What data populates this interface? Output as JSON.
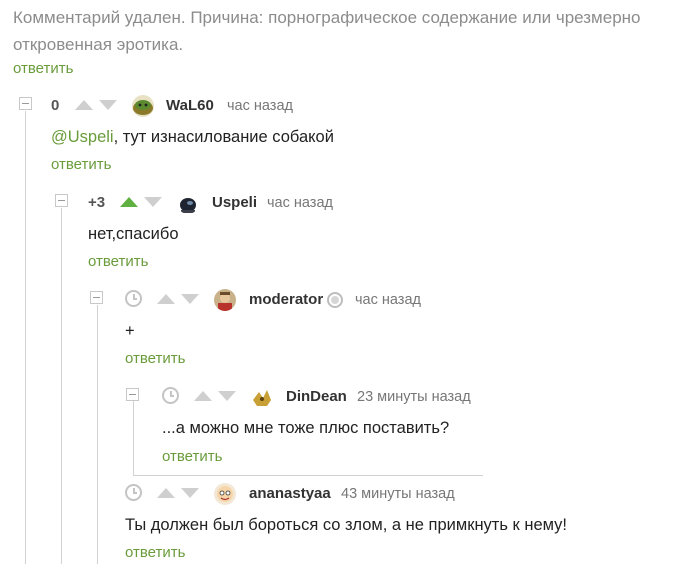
{
  "deleted_comment": {
    "text": "Комментарий удален. Причина: порнографическое содержание или чрезмерно откровенная эротика.",
    "reply_label": "ответить"
  },
  "comments": [
    {
      "rating": "0",
      "username": "WaL60",
      "time": "час назад",
      "mention": "@Uspeli",
      "text": ", тут изнасилование собакой",
      "reply_label": "ответить",
      "avatar_icon": "green-dog-avatar"
    },
    {
      "rating": "+3",
      "upvoted": true,
      "username": "Uspeli",
      "time": "час назад",
      "text": "нет,спасибо",
      "reply_label": "ответить",
      "avatar_icon": "dark-helmet-avatar"
    },
    {
      "username": "moderator",
      "time": "час назад",
      "text": "+",
      "reply_label": "ответить",
      "avatar_icon": "moderator-avatar",
      "badge_icon": "moderator-badge-icon"
    },
    {
      "username": "DinDean",
      "time": "23 минуты назад",
      "text": "...а можно мне тоже плюс поставить?",
      "reply_label": "ответить",
      "avatar_icon": "yellow-bird-avatar"
    },
    {
      "username": "ananastyaa",
      "time": "43 минуты назад",
      "text": "Ты должен был бороться со злом, а не примкнуть к нему!",
      "reply_label": "ответить",
      "avatar_icon": "cartoon-face-avatar"
    }
  ],
  "colors": {
    "link_green": "#6a9c3c",
    "upvote_active": "#5fb041",
    "arrow_inactive": "#cfcfcf",
    "muted_text": "#8c8c8c"
  }
}
